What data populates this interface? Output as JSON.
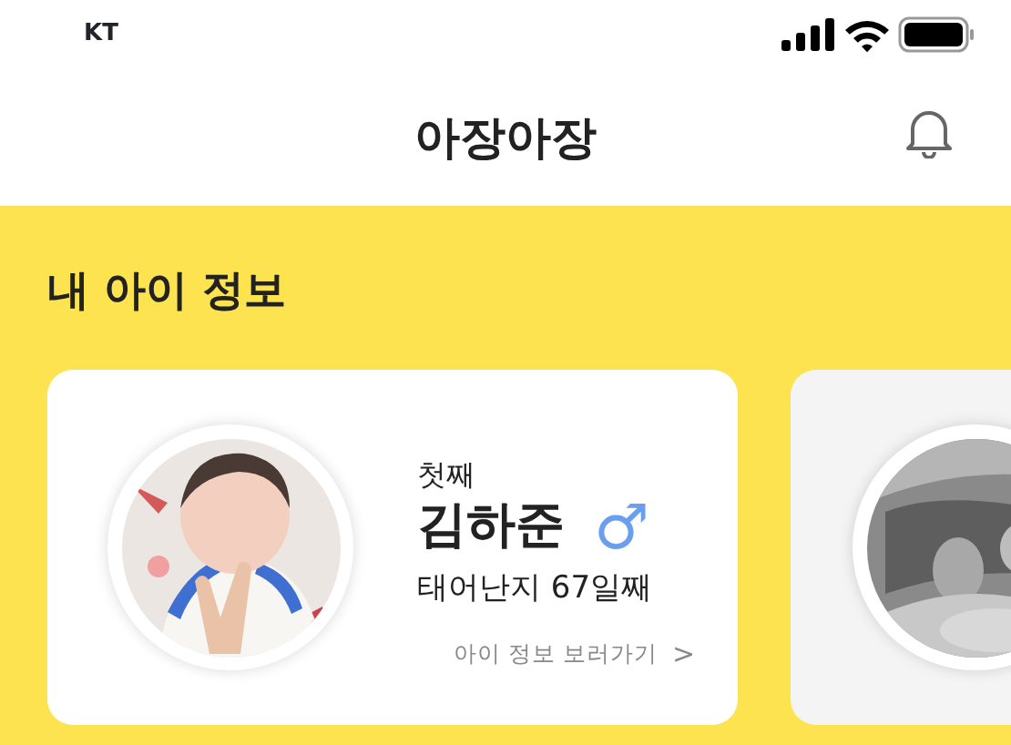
{
  "status_bar": {
    "carrier": "KT"
  },
  "header": {
    "title": "아장아장"
  },
  "section": {
    "title": "내 아이 정보"
  },
  "children": [
    {
      "photo": {
        "kind": "picture"
      },
      "order": "첫째",
      "name": "김하준",
      "gender_symbol": "♂",
      "age": "태어난지 67일째",
      "link": "아이 정보 보러가기",
      "link_arrow": ">"
    },
    {
      "photo": {
        "kind": "picture"
      }
    }
  ]
}
